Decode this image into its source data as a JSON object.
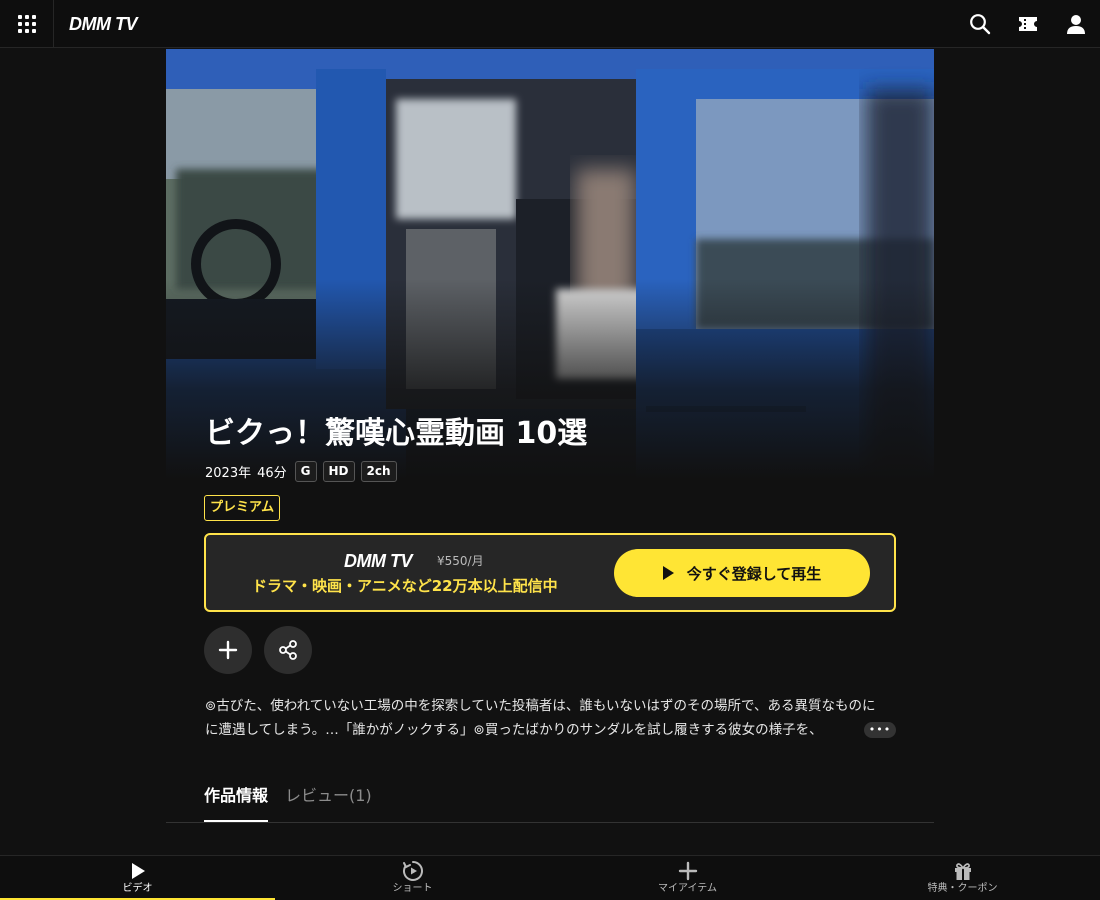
{
  "header": {
    "logo_text": "DMM TV",
    "icons": [
      "menu-grid-icon",
      "search-icon",
      "ticket-icon",
      "user-icon"
    ]
  },
  "work": {
    "title": "ビクっ！驚嘆心霊動画 10選",
    "year": "2023年",
    "duration": "46分",
    "badges": [
      "G",
      "HD",
      "2ch"
    ],
    "premium_label": "プレミアム"
  },
  "subscription": {
    "logo_text": "DMM TV",
    "price": "¥550/月",
    "tagline": "ドラマ・映画・アニメなど22万本以上配信中",
    "play_label": "今すぐ登録して再生"
  },
  "actions": {
    "add": "plus-icon",
    "share": "share-icon"
  },
  "description": {
    "line1": "⊚古びた、使われていない工場の中を探索していた投稿者は、誰もいないはずのその場所で、ある異質なものに",
    "line2": "に遭遇してしまう。…「誰かがノックする」⊚買ったばかりのサンダルを試し履きする彼女の様子を、",
    "more_label": "•••"
  },
  "tabs": [
    {
      "label": "作品情報",
      "active": true
    },
    {
      "label": "レビュー(1)",
      "active": false
    }
  ],
  "bottom_nav": [
    {
      "label": "ビデオ",
      "icon": "play-icon",
      "active": true
    },
    {
      "label": "ショート",
      "icon": "short-video-icon",
      "active": false
    },
    {
      "label": "マイアイテム",
      "icon": "plus-icon",
      "active": false
    },
    {
      "label": "特典・クーポン",
      "icon": "gift-icon",
      "active": false
    }
  ],
  "colors": {
    "accent": "#ffe534",
    "background": "#111111",
    "panel": "#262626"
  }
}
